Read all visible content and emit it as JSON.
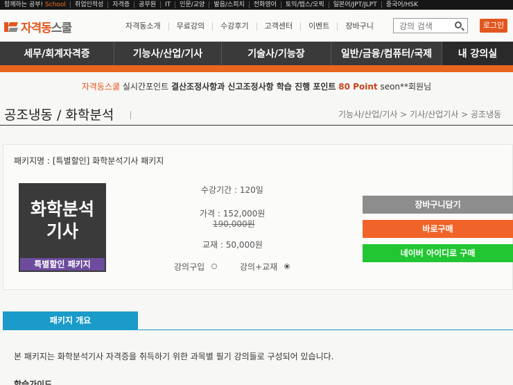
{
  "topbar": {
    "items": [
      "함께하는 공부!",
      "School",
      "취업인적성",
      "자격증",
      "공무원",
      "IT",
      "인문/교양",
      "발음/스피치",
      "전화영어",
      "토익/텝스/오픽",
      "일본어/JPT/JLPT",
      "중국어/HSK"
    ]
  },
  "header": {
    "logo_main": "자격동",
    "logo_sub": "스쿨",
    "nav": [
      "자격동소개",
      "무료강의",
      "수강후기",
      "고객센터",
      "이벤트",
      "장바구니"
    ],
    "search_placeholder": "강의 검색",
    "login_label": "로그인"
  },
  "categories": [
    "세무/회계자격증",
    "기능사/산업/기사",
    "기술사/기능장",
    "일반/금융/컴퓨터/국제",
    "내 강의실"
  ],
  "point_bar": {
    "site": "자격동스쿨",
    "label": "실시간포인트",
    "message": "결산조정사항과 신고조정사항 학습 진행 포인트",
    "points": "80 Point",
    "user": "seon**회원님"
  },
  "page": {
    "title": "공조냉동 / 화학분석",
    "breadcrumb": "기능사/산업/기사 > 기사/산업기사 > 공조냉동"
  },
  "package": {
    "name_line": "패키지명 : [특별할인] 화학분석기사 패키지",
    "thumb_line1": "화학분석",
    "thumb_line2": "기사",
    "thumb_badge": "특별할인 패키지",
    "period": "수강기간 : 120일",
    "price": "가격 : 152,000원",
    "original_price": "190,000원",
    "textbook": "교재 : 50,000원",
    "option_lecture": "강의구입",
    "option_lecture_book": "강의+교재",
    "selected_option": "강의+교재",
    "cart_button": "장바구니담기",
    "buy_button": "바로구매",
    "naver_button": "네이버 아이디로 구매"
  },
  "overview": {
    "tab_label": "패키지 개요",
    "text": "본 패키지는 화학분석기사 자격증을 취득하기 위한 과목별 필기 강의들로 구성되어 있습니다.",
    "guide_label": "학습가이드"
  },
  "colors": {
    "brand_orange": "#e2571f",
    "cart_gray": "#8d8d8d",
    "buy_orange": "#f0642a",
    "naver_green": "#21c632",
    "tab_blue": "#1a9bc9",
    "badge_purple": "#6d4c9e"
  }
}
